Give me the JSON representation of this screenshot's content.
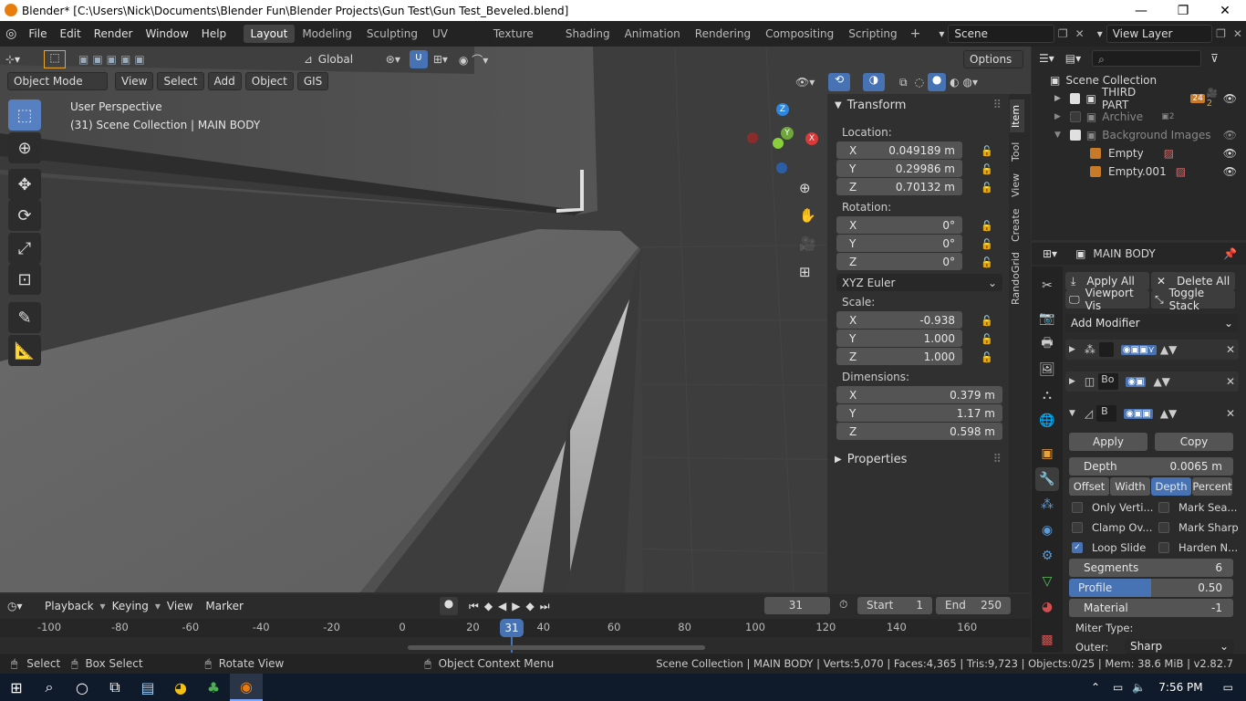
{
  "window": {
    "title": "Blender* [C:\\Users\\Nick\\Documents\\Blender Fun\\Blender Projects\\Gun Test\\Gun Test_Beveled.blend]"
  },
  "menu": [
    "File",
    "Edit",
    "Render",
    "Window",
    "Help"
  ],
  "workspaces": [
    "Layout",
    "Modeling",
    "Sculpting",
    "UV Editing",
    "Texture Paint",
    "Shading",
    "Animation",
    "Rendering",
    "Compositing",
    "Scripting"
  ],
  "scene": "Scene",
  "view_layer": "View Layer",
  "header": {
    "orientation": "Global",
    "options": "Options"
  },
  "viewport_header": {
    "mode": "Object Mode",
    "menus": [
      "View",
      "Select",
      "Add",
      "Object",
      "GIS"
    ]
  },
  "viewport": {
    "perspective": "User Perspective",
    "collection_info": "(31) Scene Collection | MAIN BODY"
  },
  "gizmo": {
    "x": "X",
    "y": "Y",
    "z": "Z"
  },
  "npanel": {
    "tabs": [
      "Item",
      "Tool",
      "View",
      "Create",
      "RandoGrid"
    ],
    "transform_header": "Transform",
    "location_label": "Location:",
    "location": [
      {
        "axis": "X",
        "value": "0.049189 m"
      },
      {
        "axis": "Y",
        "value": "0.29986 m"
      },
      {
        "axis": "Z",
        "value": "0.70132 m"
      }
    ],
    "rotation_label": "Rotation:",
    "rotation": [
      {
        "axis": "X",
        "value": "0°"
      },
      {
        "axis": "Y",
        "value": "0°"
      },
      {
        "axis": "Z",
        "value": "0°"
      }
    ],
    "rotation_mode": "XYZ Euler",
    "scale_label": "Scale:",
    "scale": [
      {
        "axis": "X",
        "value": "-0.938"
      },
      {
        "axis": "Y",
        "value": "1.000"
      },
      {
        "axis": "Z",
        "value": "1.000"
      }
    ],
    "dimensions_label": "Dimensions:",
    "dimensions": [
      {
        "axis": "X",
        "value": "0.379 m"
      },
      {
        "axis": "Y",
        "value": "1.17 m"
      },
      {
        "axis": "Z",
        "value": "0.598 m"
      }
    ],
    "properties_header": "Properties"
  },
  "timeline": {
    "menus": [
      "Playback",
      "Keying",
      "View",
      "Marker"
    ],
    "current_frame": "31",
    "start_label": "Start",
    "start": "1",
    "end_label": "End",
    "end": "250",
    "ticks": [
      "-100",
      "-80",
      "-60",
      "-40",
      "-20",
      "0",
      "20",
      "40",
      "60",
      "80",
      "100",
      "120",
      "140",
      "160"
    ],
    "playhead": "31"
  },
  "outliner": {
    "root": "Scene Collection",
    "items": [
      {
        "name": "THIRD PART",
        "badge1": "24",
        "badge2": "2"
      },
      {
        "name": "Archive",
        "badge1": "2"
      },
      {
        "name": "Background Images"
      },
      {
        "name": "Empty"
      },
      {
        "name": "Empty.001"
      }
    ]
  },
  "properties": {
    "object_name": "MAIN BODY",
    "apply_all": "Apply All",
    "delete_all": "Delete All",
    "viewport_vis": "Viewport Vis",
    "toggle_stack": "Toggle Stack",
    "add_modifier": "Add Modifier",
    "mod2_name": "Bo",
    "mod3_name": "B",
    "apply": "Apply",
    "copy": "Copy",
    "depth_label": "Depth",
    "depth_value": "0.0065 m",
    "width_types": [
      "Offset",
      "Width",
      "Depth",
      "Percent"
    ],
    "checks": [
      {
        "label": "Only Verti...",
        "on": false
      },
      {
        "label": "Mark Sea...",
        "on": false
      },
      {
        "label": "Clamp Ov...",
        "on": false
      },
      {
        "label": "Mark Sharp",
        "on": false
      },
      {
        "label": "Loop Slide",
        "on": true
      },
      {
        "label": "Harden N...",
        "on": false
      }
    ],
    "segments_label": "Segments",
    "segments_value": "6",
    "profile_label": "Profile",
    "profile_value": "0.50",
    "profile_fraction": 0.5,
    "material_label": "Material",
    "material_value": "-1",
    "miter_label": "Miter Type:",
    "outer_label": "Outer:",
    "outer_value": "Sharp"
  },
  "statusbar": {
    "select": "Select",
    "box_select": "Box Select",
    "rotate_view": "Rotate View",
    "context_menu": "Object Context Menu",
    "stats": "Scene Collection | MAIN BODY | Verts:5,070 | Faces:4,365 | Tris:9,723 | Objects:0/25 | Mem: 38.6 MiB | v2.82.7"
  },
  "taskbar": {
    "time": "7:56 PM"
  }
}
